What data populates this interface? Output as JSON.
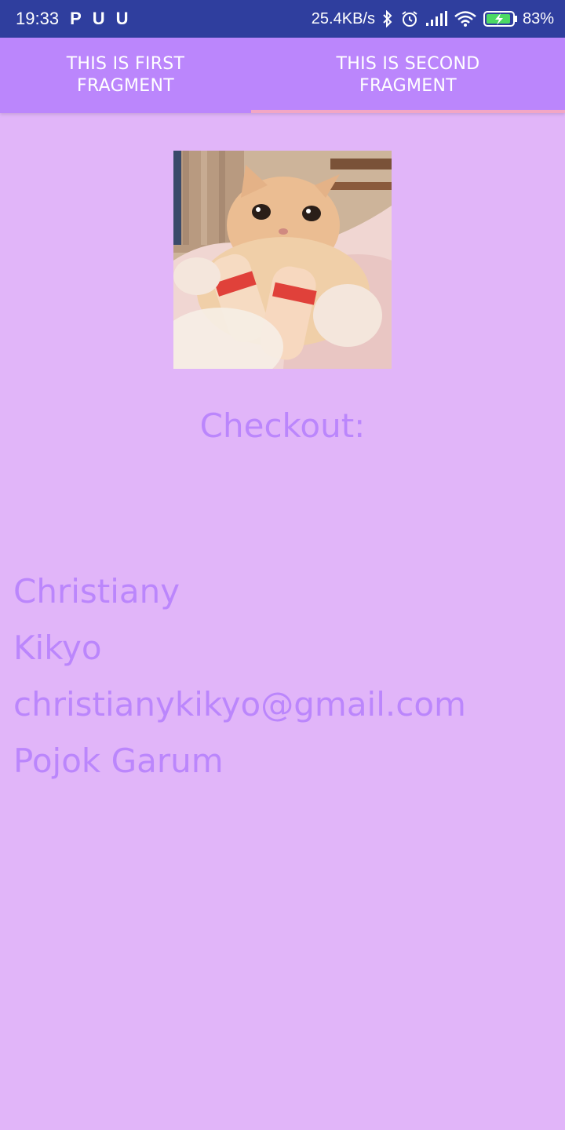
{
  "status_bar": {
    "time": "19:33",
    "app_icons": [
      "P",
      "U",
      "U"
    ],
    "network_speed": "25.4KB/s",
    "battery_percent": "83%",
    "icons": [
      "bluetooth-icon",
      "alarm-icon",
      "signal-icon",
      "wifi-icon",
      "battery-charging-icon"
    ]
  },
  "tabs": [
    {
      "label": "THIS IS FIRST FRAGMENT",
      "selected": false
    },
    {
      "label": "THIS IS SECOND FRAGMENT",
      "selected": true
    }
  ],
  "content": {
    "checkout_label": "Checkout:",
    "first_name": "Christiany",
    "last_name": "Kikyo",
    "email": "christianykikyo@gmail.com",
    "address": "Pojok Garum"
  },
  "colors": {
    "status_bar": "#2f3e9e",
    "tab_bar": "#bb86fc",
    "background": "#e1b5f9",
    "text_accent": "#bb86fc",
    "tab_indicator": "#f2a6c5"
  }
}
